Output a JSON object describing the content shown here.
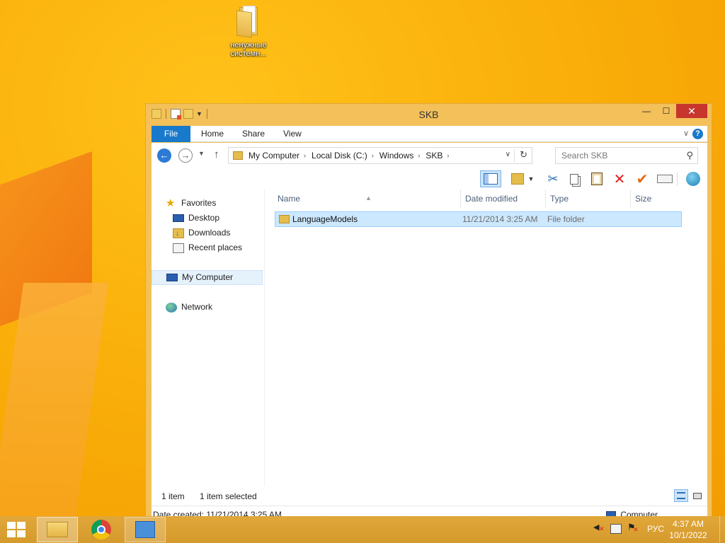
{
  "desktop": {
    "icon_label_line1": "ненужные",
    "icon_label_line2": "системн..."
  },
  "window": {
    "title": "SKB",
    "minimize_glyph": "—",
    "maximize_glyph": "☐",
    "close_glyph": "✕"
  },
  "ribbon": {
    "tabs": {
      "file": "File",
      "home": "Home",
      "share": "Share",
      "view": "View"
    },
    "expand_glyph": "∨",
    "help_glyph": "?"
  },
  "address": {
    "breadcrumbs": [
      "My Computer",
      "Local Disk (C:)",
      "Windows",
      "SKB"
    ],
    "separator": "›"
  },
  "search": {
    "placeholder": "Search SKB"
  },
  "navpane": {
    "favorites": "Favorites",
    "desktop": "Desktop",
    "downloads": "Downloads",
    "recent_places": "Recent places",
    "my_computer": "My Computer",
    "network": "Network"
  },
  "columns": {
    "name": "Name",
    "date_modified": "Date modified",
    "type": "Type",
    "size": "Size"
  },
  "files": [
    {
      "name": "LanguageModels",
      "date_modified": "11/21/2014 3:25 AM",
      "type": "File folder",
      "size": ""
    }
  ],
  "status": {
    "item_count": "1 item",
    "selected": "1 item selected"
  },
  "details": {
    "date_created": "Date created: 11/21/2014 3:25 AM",
    "location": "Computer"
  },
  "taskbar": {
    "language": "РУС",
    "time": "4:37 AM",
    "date": "10/1/2022"
  },
  "colors": {
    "accent": "#1979ca",
    "selection": "#cce8ff",
    "desktop": "#f6a800",
    "close": "#c7352d"
  }
}
